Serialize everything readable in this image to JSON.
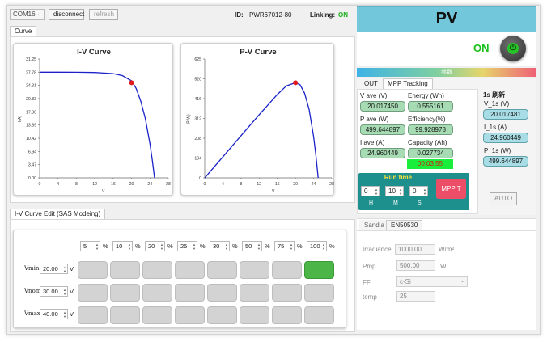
{
  "toolbar": {
    "port": "COM16",
    "disconnect": "disconnect",
    "refresh": "refresh",
    "id_label": "ID:",
    "id_value": "PWR67012-80",
    "linking_label": "Linking:",
    "linking_value": "ON"
  },
  "curve_tab": "Curve",
  "iv_chart": {
    "title": "I-V Curve",
    "ylabel": "I(A)",
    "xlabel": "V",
    "yticks": [
      "31.25",
      "27.78",
      "24.31",
      "20.83",
      "17.36",
      "13.89",
      "10.42",
      "6.94",
      "3.47",
      "0.00"
    ],
    "xticks": [
      "0",
      "4",
      "8",
      "12",
      "16",
      "20",
      "24",
      "28"
    ]
  },
  "pv_chart": {
    "title": "P-V Curve",
    "ylabel": "P(W)",
    "xlabel": "V",
    "yticks": [
      "625",
      "520",
      "416",
      "312",
      "208",
      "104",
      "0"
    ],
    "xticks": [
      "0",
      "4",
      "8",
      "12",
      "16",
      "20",
      "24",
      "28"
    ]
  },
  "chart_data": [
    {
      "type": "line",
      "title": "I-V Curve",
      "xlabel": "V",
      "ylabel": "I(A)",
      "xlim": [
        0,
        28
      ],
      "ylim": [
        0,
        31.25
      ],
      "series": [
        {
          "x": [
            0,
            4,
            8,
            12,
            16,
            18,
            20,
            21,
            22,
            23,
            24,
            24.5,
            25
          ],
          "y": [
            27.78,
            27.78,
            27.76,
            27.7,
            27.4,
            26.9,
            25.5,
            23.5,
            20.2,
            15.6,
            9.0,
            4.8,
            0
          ]
        }
      ],
      "mpp": {
        "x": 20,
        "y": 25
      }
    },
    {
      "type": "line",
      "title": "P-V Curve",
      "xlabel": "V",
      "ylabel": "P(W)",
      "xlim": [
        0,
        28
      ],
      "ylim": [
        0,
        625
      ],
      "series": [
        {
          "x": [
            0,
            2,
            4,
            8,
            12,
            16,
            18,
            20,
            21,
            22,
            23,
            24,
            24.5,
            25
          ],
          "y": [
            0,
            55,
            110,
            222,
            332,
            438,
            484,
            500,
            490,
            445,
            360,
            216,
            118,
            0
          ]
        }
      ],
      "mpp": {
        "x": 20,
        "y": 500
      }
    }
  ],
  "sas": {
    "tab": "I-V Curve Edit (SAS Modeing)",
    "pcts": [
      "5",
      "10",
      "20",
      "25",
      "30",
      "50",
      "75",
      "100"
    ],
    "pct_sign": "%",
    "rows": [
      {
        "label": "Vmin",
        "value": "20.00",
        "unit": "V"
      },
      {
        "label": "Vnom",
        "value": "30.00",
        "unit": "V"
      },
      {
        "label": "Vmax",
        "value": "40.00",
        "unit": "V"
      }
    ],
    "active_cell": "row1-col8"
  },
  "pv": {
    "title": "PV",
    "state": "ON",
    "section": "参数",
    "tab_out": "OUT",
    "tab_mpp": "MPP Tracking",
    "fields": [
      {
        "label": "V ave (V)",
        "value": "20.017450"
      },
      {
        "label": "Energy (Wh)",
        "value": "0.555161"
      },
      {
        "label": "P ave (W)",
        "value": "499.644897"
      },
      {
        "label": "Efficiency(%)",
        "value": "99.928978"
      },
      {
        "label": "I ave (A)",
        "value": "24.960449"
      },
      {
        "label": "Capacity (Ah)",
        "value": "0.027734"
      }
    ],
    "timer": "00:03:55",
    "refresh_title": "1s 刷新",
    "r_fields": [
      {
        "label": "V_1s (V)",
        "value": "20.017481"
      },
      {
        "label": "I_1s (A)",
        "value": "24.960449"
      },
      {
        "label": "P_1s (W)",
        "value": "499.644897"
      }
    ],
    "run": {
      "title": "Run time",
      "h": "0",
      "m": "10",
      "s": "0",
      "h_lbl": "H",
      "m_lbl": "M",
      "s_lbl": "S",
      "btn": "MPP T"
    },
    "auto": "AUTO"
  },
  "params": {
    "tab1": "Sandia",
    "tab2": "EN50530",
    "irr_label": "Irradiance",
    "irr_value": "1000.00",
    "irr_unit": "W/m²",
    "pmp_label": "Pmp",
    "pmp_value": "500.00",
    "pmp_unit": "W",
    "ff_label": "FF",
    "ff_value": "c-Si",
    "temp_label": "temp",
    "temp_value": "25"
  },
  "colors": {
    "header": "#73c7db",
    "curve": "#1a22c8",
    "mpp": "#e01b1b",
    "run_box": "#1d8f8c",
    "mpp_btn": "#ec4d67",
    "on": "#19c019",
    "timer_bg": "#19ef3a",
    "timer_fg": "#d41b1b"
  }
}
